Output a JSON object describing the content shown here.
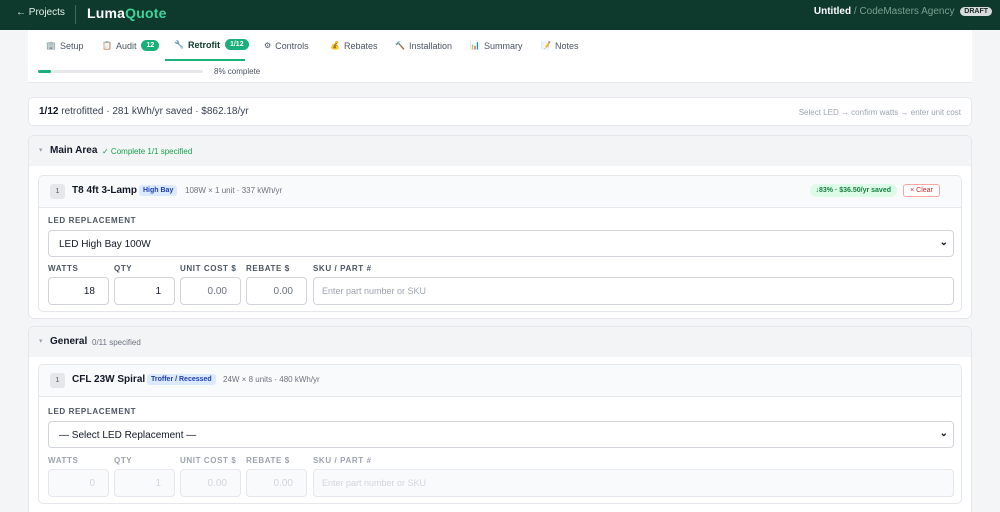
{
  "topbar": {
    "back_label": "← Projects",
    "logo_part1": "Luma",
    "logo_part2": "Quote",
    "project_title": "Untitled",
    "separator": " / ",
    "agency": "CodeMasters Agency",
    "status_badge": "DRAFT"
  },
  "tabs": [
    {
      "label": "Setup",
      "icon": "🏢",
      "icon_name": "building-icon"
    },
    {
      "label": "Audit",
      "icon": "📋",
      "icon_name": "clipboard-icon",
      "badge": "12"
    },
    {
      "label": "Retrofit",
      "icon": "🔧",
      "icon_name": "wrench-icon",
      "badge": "1/12",
      "active": true
    },
    {
      "label": "Controls",
      "icon": "⚙",
      "icon_name": "gear-icon"
    },
    {
      "label": "Rebates",
      "icon": "💰",
      "icon_name": "money-bag-icon"
    },
    {
      "label": "Installation",
      "icon": "🔨",
      "icon_name": "hammer-icon"
    },
    {
      "label": "Summary",
      "icon": "📊",
      "icon_name": "bar-chart-icon"
    },
    {
      "label": "Notes",
      "icon": "📝",
      "icon_name": "notes-icon"
    }
  ],
  "progress": {
    "percent": 8,
    "label": "8% complete"
  },
  "summary": {
    "count": "1/12",
    "text": " retrofitted · 281 kWh/yr saved · $862.18/yr",
    "hint": "Select LED → confirm watts → enter unit cost"
  },
  "field_labels": {
    "led_replacement": "LED REPLACEMENT",
    "watts": "WATTS",
    "qty": "QTY",
    "unit_cost": "UNIT COST $",
    "rebate": "REBATE $",
    "sku": "SKU / PART #"
  },
  "areas": [
    {
      "title": "Main Area",
      "status": "✓ Complete 1/1 specified",
      "status_color": "#16a34a",
      "fixture": {
        "num": "1",
        "title": "T8 4ft 3-Lamp",
        "type": "High Bay",
        "spec": "108W × 1 unit · 337 kWh/yr",
        "savings": "↓83% · $36.50/yr saved",
        "clear_label": "× Clear",
        "led_selected": "LED High Bay 100W",
        "watts": "18",
        "qty": "1",
        "unit_cost": "0.00",
        "rebate": "0.00",
        "sku_placeholder": "Enter part number or SKU"
      }
    },
    {
      "title": "General",
      "status": "0/11 specified",
      "status_color": "#6b7280",
      "fixture": {
        "num": "1",
        "title": "CFL 23W Spiral",
        "type": "Troffer / Recessed",
        "spec": "24W × 8 units · 480 kWh/yr",
        "led_selected": "— Select LED Replacement —",
        "watts": "0",
        "qty": "1",
        "unit_cost": "0.00",
        "rebate": "0.00",
        "sku_placeholder": "Enter part number or SKU"
      }
    }
  ],
  "colors": {
    "topbar_bg": "#0d3a2c",
    "accent": "#19b07a",
    "success": "#16a34a",
    "danger": "#dc2626"
  }
}
